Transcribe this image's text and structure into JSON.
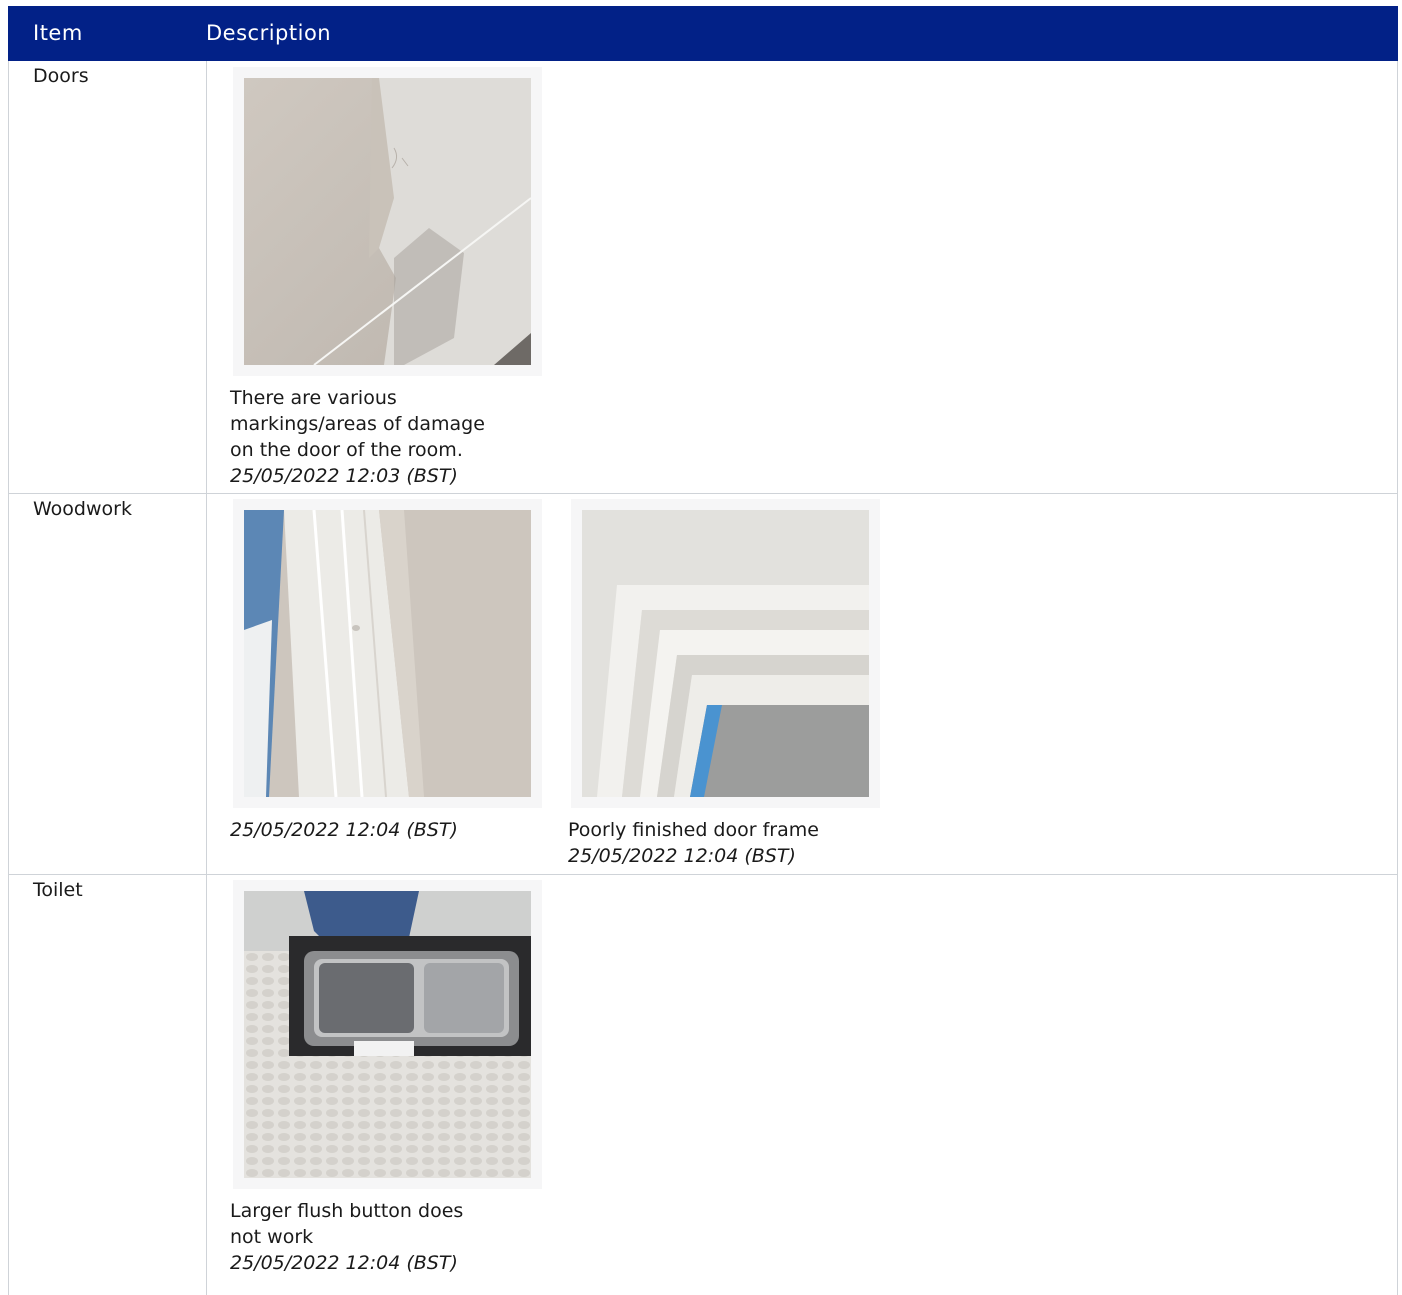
{
  "header": {
    "item": "Item",
    "description": "Description"
  },
  "rows": [
    {
      "item": "Doors",
      "photos": [
        {
          "note_lines": [
            "There are various",
            "markings/areas of damage",
            "on the door of the room."
          ],
          "timestamp": "25/05/2022 12:03 (BST)"
        }
      ]
    },
    {
      "item": "Woodwork",
      "photos": [
        {
          "note_lines": [],
          "timestamp": "25/05/2022 12:04 (BST)"
        },
        {
          "note_lines": [
            "Poorly finished door frame"
          ],
          "timestamp": "25/05/2022 12:04 (BST)"
        }
      ]
    },
    {
      "item": "Toilet",
      "photos": [
        {
          "note_lines": [
            "Larger flush button does",
            "not work"
          ],
          "timestamp": "25/05/2022 12:04 (BST)"
        }
      ]
    }
  ]
}
